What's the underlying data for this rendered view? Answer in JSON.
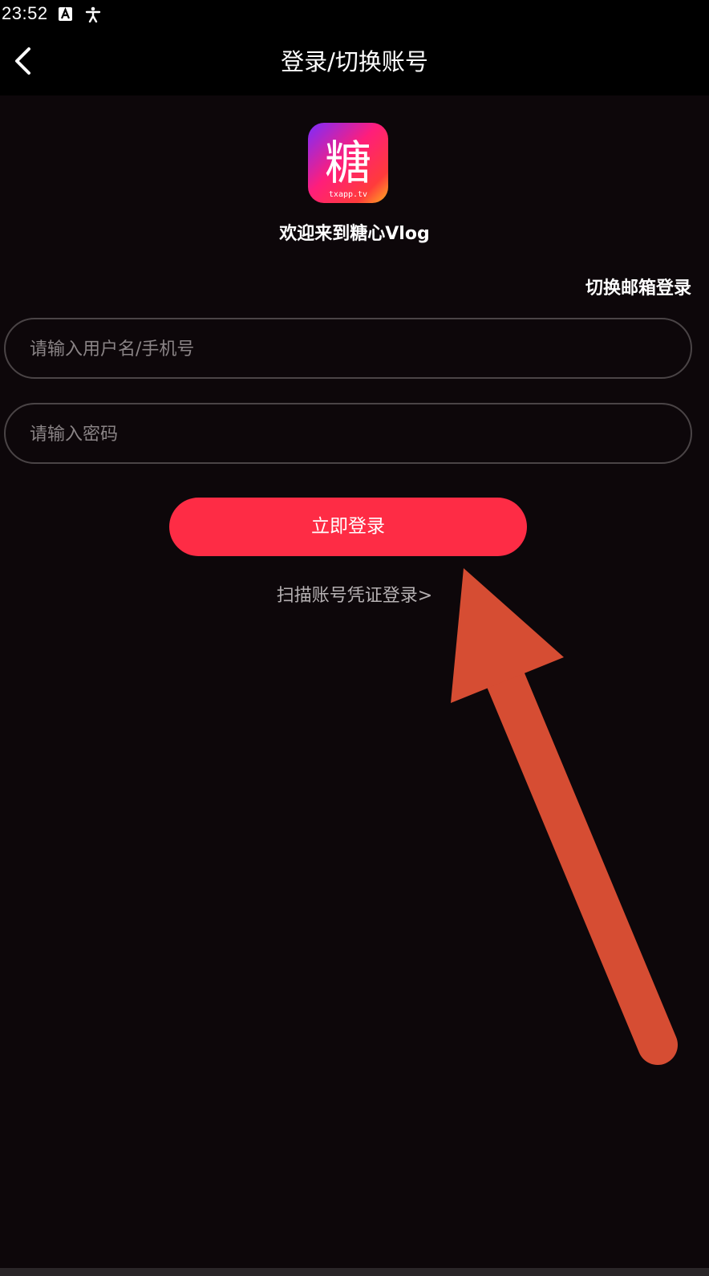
{
  "status_bar": {
    "time": "23:52",
    "icons": [
      "keyboard-a-icon",
      "accessibility-icon"
    ]
  },
  "nav": {
    "title": "登录/切换账号",
    "back_icon": "chevron-left-icon"
  },
  "brand": {
    "logo_char": "糖",
    "logo_domain": "txapp.tv",
    "welcome": "欢迎来到糖心Vlog"
  },
  "form": {
    "switch_email_label": "切换邮箱登录",
    "username": {
      "value": "",
      "placeholder": "请输入用户名/手机号"
    },
    "password": {
      "value": "",
      "placeholder": "请输入密码"
    },
    "login_label": "立即登录",
    "scan_label": "扫描账号凭证登录>"
  },
  "colors": {
    "background": "#0d070a",
    "accent": "#fe2c45",
    "annotation_arrow": "#d64d33"
  }
}
